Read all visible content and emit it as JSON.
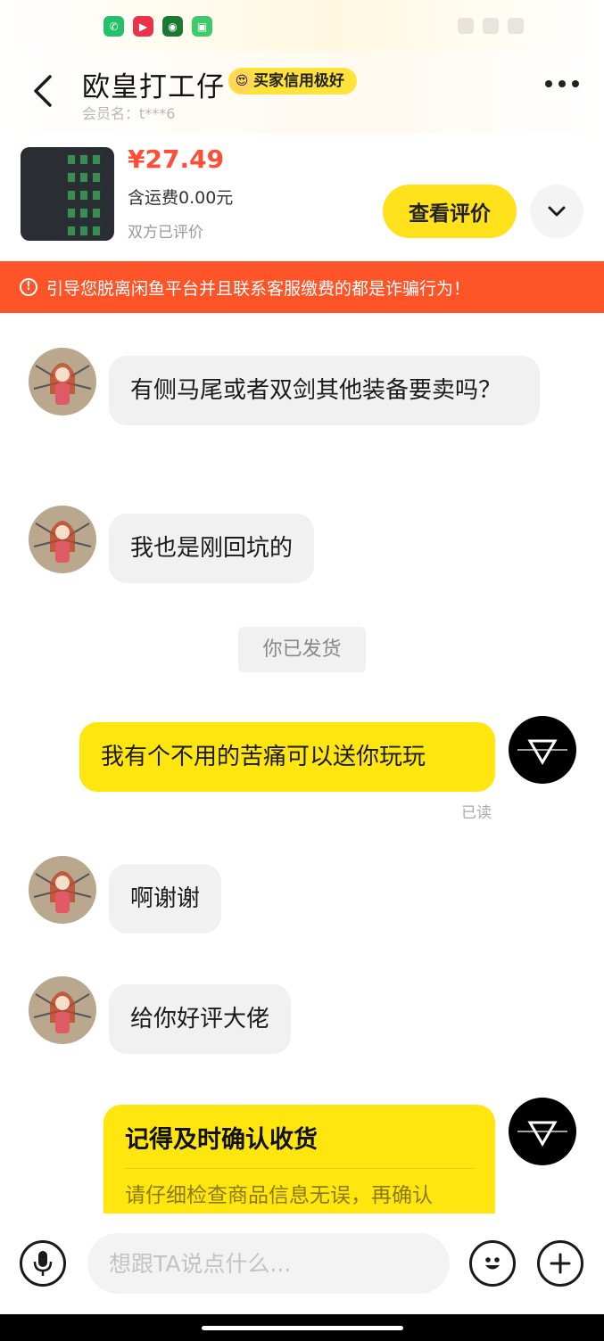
{
  "status_bar": {
    "apps": [
      "phone-app-icon",
      "video-app-icon",
      "game-app-icon",
      "store-app-icon"
    ]
  },
  "header": {
    "title": "欧皇打工仔",
    "credit_badge": "买家信用极好",
    "member_label": "会员名：t***6"
  },
  "product": {
    "price": "¥27.49",
    "shipping": "含运费0.00元",
    "eval_status": "双方已评价",
    "review_button": "查看评价"
  },
  "warning": {
    "icon": "!",
    "text": "引导您脱离闲鱼平台并且联系客服缴费的都是诈骗行为！"
  },
  "messages": [
    {
      "side": "in",
      "text": "有侧马尾或者双剑其他装备要卖吗？"
    },
    {
      "side": "in",
      "text": "我也是刚回坑的"
    },
    {
      "side": "system",
      "text": "你已发货"
    },
    {
      "side": "out",
      "text": "我有个不用的苦痛可以送你玩玩",
      "status": "已读"
    },
    {
      "side": "in",
      "text": "啊谢谢"
    },
    {
      "side": "in",
      "text": "给你好评大佬"
    }
  ],
  "reminder_card": {
    "title": "记得及时确认收货",
    "body": "请仔细检查商品信息无误，再确认"
  },
  "input_bar": {
    "placeholder": "想跟TA说点什么..."
  },
  "colors": {
    "brand_yellow": "#ffe60f",
    "warning_red": "#ff5328",
    "price_red": "#ff4d37"
  }
}
